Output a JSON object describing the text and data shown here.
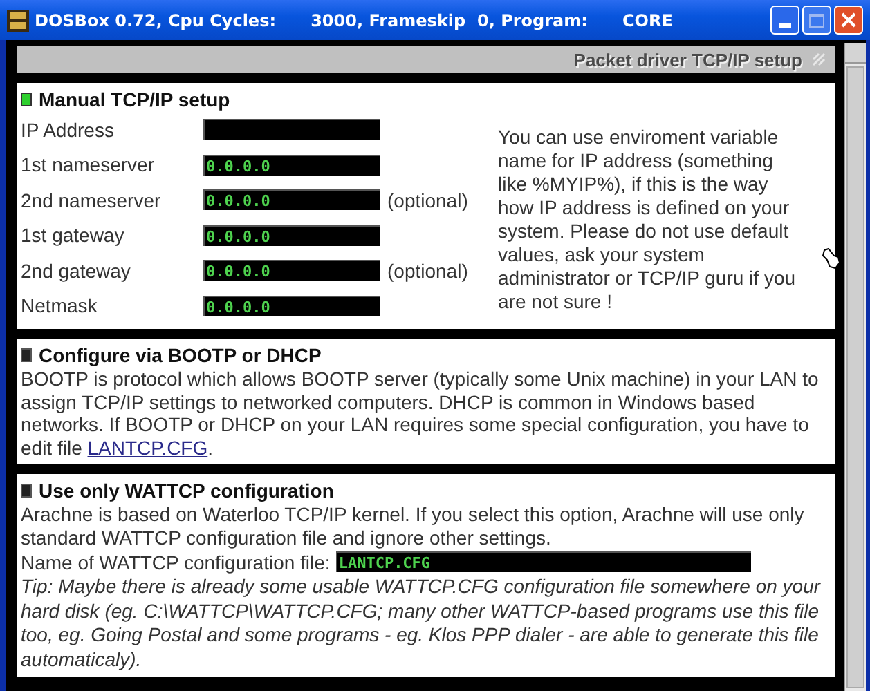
{
  "window": {
    "title": "DOSBox 0.72, Cpu Cycles:      3000, Frameskip  0, Program:      CORE"
  },
  "header": {
    "title": "Packet driver TCP/IP setup"
  },
  "sections": [
    {
      "kind": "manual",
      "title": "Manual TCP/IP setup",
      "selected": true,
      "fields": [
        {
          "label": "IP Address"
        },
        {
          "label": "1st nameserver",
          "value": "0.0.0.0"
        },
        {
          "label": "2nd nameserver",
          "value": "0.0.0.0",
          "note": "(optional)"
        },
        {
          "label": "1st gateway",
          "value": "0.0.0.0"
        },
        {
          "label": "2nd gateway",
          "value": "0.0.0.0",
          "note": "(optional)"
        },
        {
          "label": "Netmask",
          "value": "0.0.0.0"
        }
      ],
      "help": "You can use enviroment variable name for IP address (something like %MYIP%), if this is the way how IP address is defined on your system. Please do not use default values, ask your system administrator or TCP/IP guru if you are not sure !"
    },
    {
      "kind": "dhcp",
      "title": "Configure via BOOTP or DHCP",
      "selected": false,
      "text": "BOOTP is protocol which allows BOOTP server (typically some Unix machine) in your LAN to assign TCP/IP settings to networked computers. DHCP is common in Windows based networks. If BOOTP or DHCP on your LAN requires some special configuration, you have to edit file",
      "link": "LANTCP.CFG",
      "after": "."
    },
    {
      "kind": "wattcp",
      "title": "Use only WATTCP configuration",
      "selected": false,
      "text": "Arachne is based on Waterloo TCP/IP kernel. If you select this option, Arachne will use only standard WATTCP configuration file and ignore other settings.",
      "field": {
        "label": "Name of WATTCP configuration file:",
        "value": "LANTCP.CFG"
      },
      "tip": "Tip: Maybe there is already some usable WATTCP.CFG configuration file somewhere on your hard disk (eg. C:\\WATTCP\\WATTCP.CFG; many other WATTCP-based programs use this file too, eg. Going Postal and some programs - eg. Klos PPP dialer - are able to generate this file automaticaly)."
    }
  ]
}
